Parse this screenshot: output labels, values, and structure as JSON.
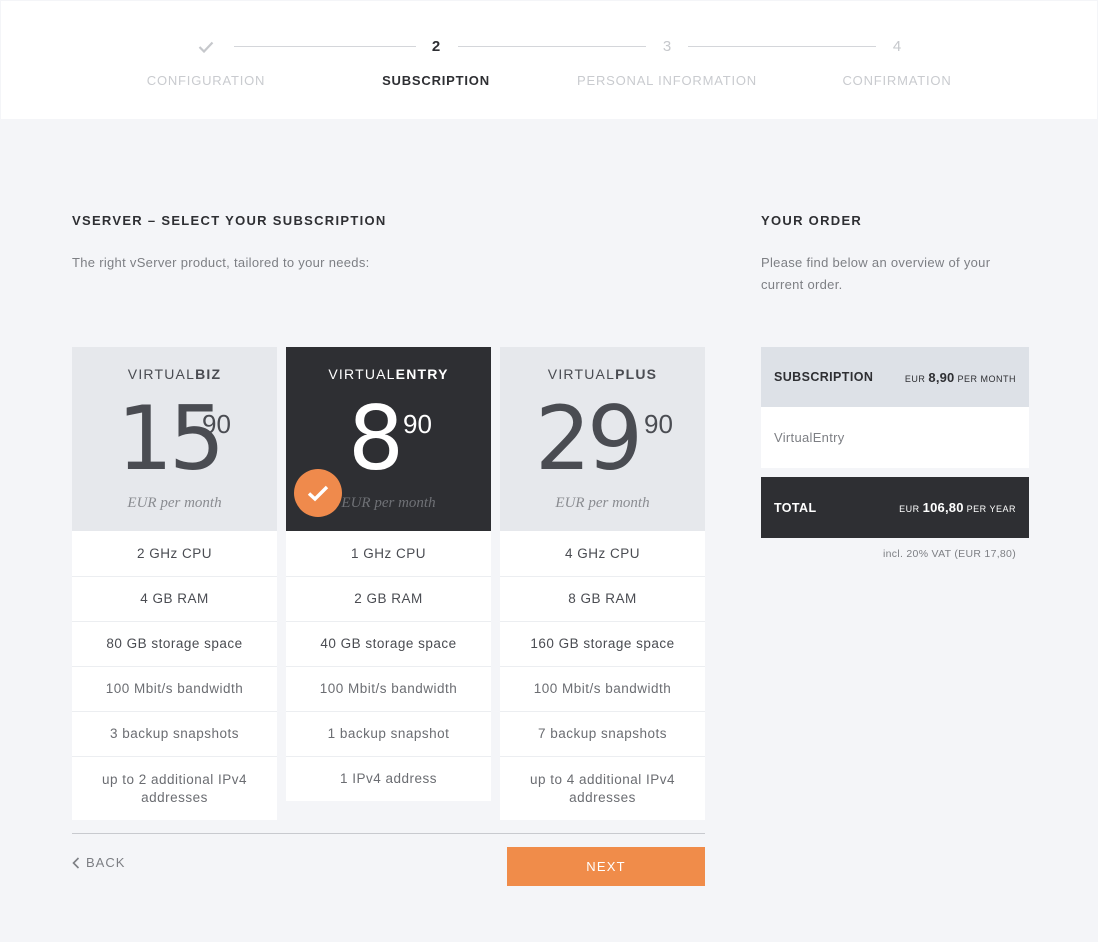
{
  "stepper": {
    "steps": [
      {
        "number": "",
        "label": "CONFIGURATION",
        "state": "done"
      },
      {
        "number": "2",
        "label": "SUBSCRIPTION",
        "state": "active"
      },
      {
        "number": "3",
        "label": "PERSONAL INFORMATION",
        "state": "pending"
      },
      {
        "number": "4",
        "label": "CONFIRMATION",
        "state": "pending"
      }
    ]
  },
  "main": {
    "title": "VSERVER – SELECT YOUR SUBSCRIPTION",
    "subtitle": "The right vServer product, tailored to your needs:"
  },
  "plans": [
    {
      "name_prefix": "VIRTUAL",
      "name_bold": "BIZ",
      "price_main": "15",
      "price_cents": "90",
      "per_month": "EUR per month",
      "selected": false,
      "features": [
        "2 GHz CPU",
        "4 GB RAM",
        "80 GB storage space",
        "100 Mbit/s bandwidth",
        "3 backup snapshots",
        "up to 2 additional IPv4 addresses"
      ]
    },
    {
      "name_prefix": "VIRTUAL",
      "name_bold": "ENTRY",
      "price_main": "8",
      "price_cents": "90",
      "per_month": "EUR per month",
      "selected": true,
      "features": [
        "1 GHz CPU",
        "2 GB RAM",
        "40 GB storage space",
        "100 Mbit/s bandwidth",
        "1 backup snapshot",
        "1 IPv4 address"
      ]
    },
    {
      "name_prefix": "VIRTUAL",
      "name_bold": "PLUS",
      "price_main": "29",
      "price_cents": "90",
      "per_month": "EUR per month",
      "selected": false,
      "features": [
        "4 GHz CPU",
        "8 GB RAM",
        "160 GB storage space",
        "100 Mbit/s bandwidth",
        "7 backup snapshots",
        "up to 4 additional IPv4 addresses"
      ]
    }
  ],
  "nav": {
    "back_label": "BACK",
    "next_label": "NEXT"
  },
  "order": {
    "title": "YOUR ORDER",
    "description": "Please find below an overview of your current order.",
    "subscription_label": "SUBSCRIPTION",
    "subscription_currency": "EUR",
    "subscription_amount": "8,90",
    "subscription_period": "PER MONTH",
    "item": "VirtualEntry",
    "total_label": "TOTAL",
    "total_currency": "EUR",
    "total_amount": "106,80",
    "total_period": "PER YEAR",
    "vat_note": "incl. 20% VAT (EUR 17,80)"
  },
  "colors": {
    "accent": "#f08c4a",
    "dark": "#2e2f33",
    "background": "#f4f5f8"
  }
}
